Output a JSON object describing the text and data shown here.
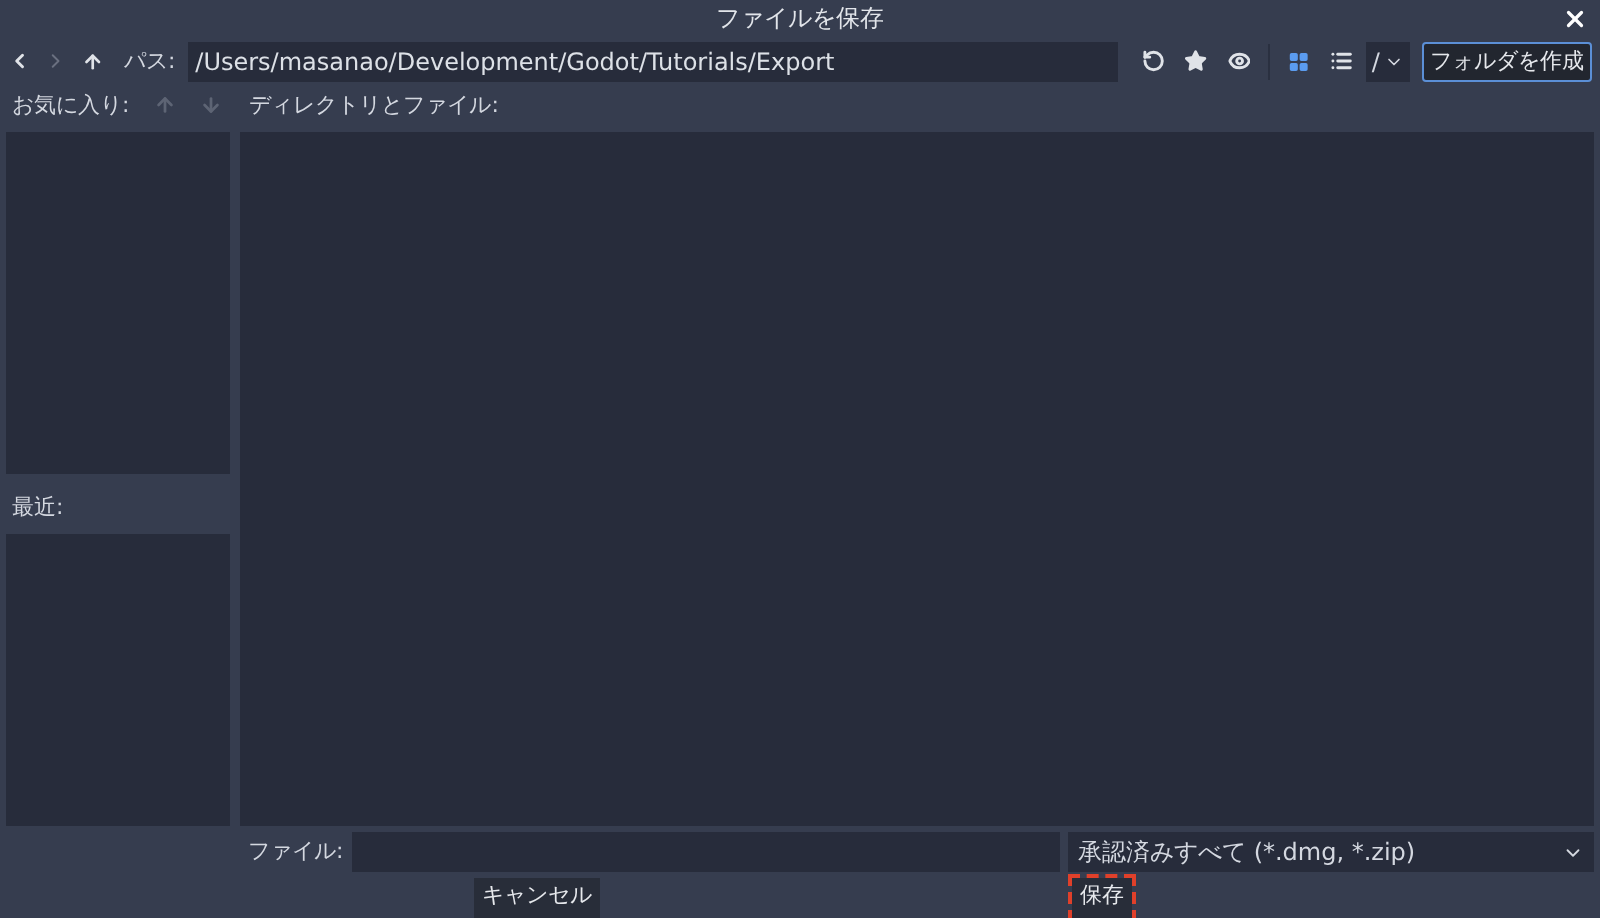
{
  "window": {
    "title": "ファイルを保存"
  },
  "toolbar": {
    "path_label": "パス:",
    "path": "/Users/masanao/Development/Godot/Tutorials/Export",
    "view_buttons": [
      {
        "kind": "grid",
        "selected": true
      },
      {
        "kind": "list",
        "selected": false
      }
    ],
    "drive": "/",
    "create_folder": "フォルダを作成"
  },
  "favorites": {
    "label": "お気に入り:",
    "move_up_disabled": true,
    "move_down_disabled": true
  },
  "recent": {
    "label": "最近:"
  },
  "files": {
    "label": "ディレクトリとファイル:"
  },
  "file_row": {
    "label": "ファイル:",
    "filter": "承認済みすべて (*.dmg, *.zip)"
  },
  "buttons": [
    {
      "label": "キャンセル",
      "highlighted": false
    },
    {
      "label": "保存",
      "highlighted": true
    }
  ]
}
